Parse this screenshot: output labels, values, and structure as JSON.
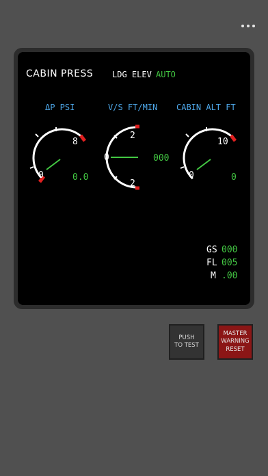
{
  "header": {
    "more_icon": "more-horizontal-icon"
  },
  "panel": {
    "title": "CABIN PRESS",
    "ldg_elev_label": "LDG ELEV",
    "ldg_elev_value": "AUTO"
  },
  "gauges": [
    {
      "label": "ΔP PSI",
      "max_label": "8",
      "min_label": "0",
      "digital": "0.0",
      "needle_deg": -45
    },
    {
      "label": "V/S FT/MIN",
      "top_label": "2",
      "mid_label": "0",
      "bottom_label": "2",
      "digital": "000",
      "needle_deg": 90
    },
    {
      "label": "CABIN ALT FT",
      "max_label": "10",
      "min_label": "0",
      "digital": "0",
      "needle_deg": -45
    }
  ],
  "flight": {
    "gs_label": "GS",
    "gs_value": "000",
    "fl_label": "FL",
    "fl_value": "005",
    "m_label": "M",
    "m_value": ".00"
  },
  "buttons": {
    "push_to_test": "PUSH\nTO TEST",
    "master_warning": "MASTER\nWARNING\nRESET"
  },
  "colors": {
    "label_blue": "#4ea8ea",
    "value_green": "#43c843",
    "limit_red": "#e02020",
    "master_red": "#8b1616"
  }
}
